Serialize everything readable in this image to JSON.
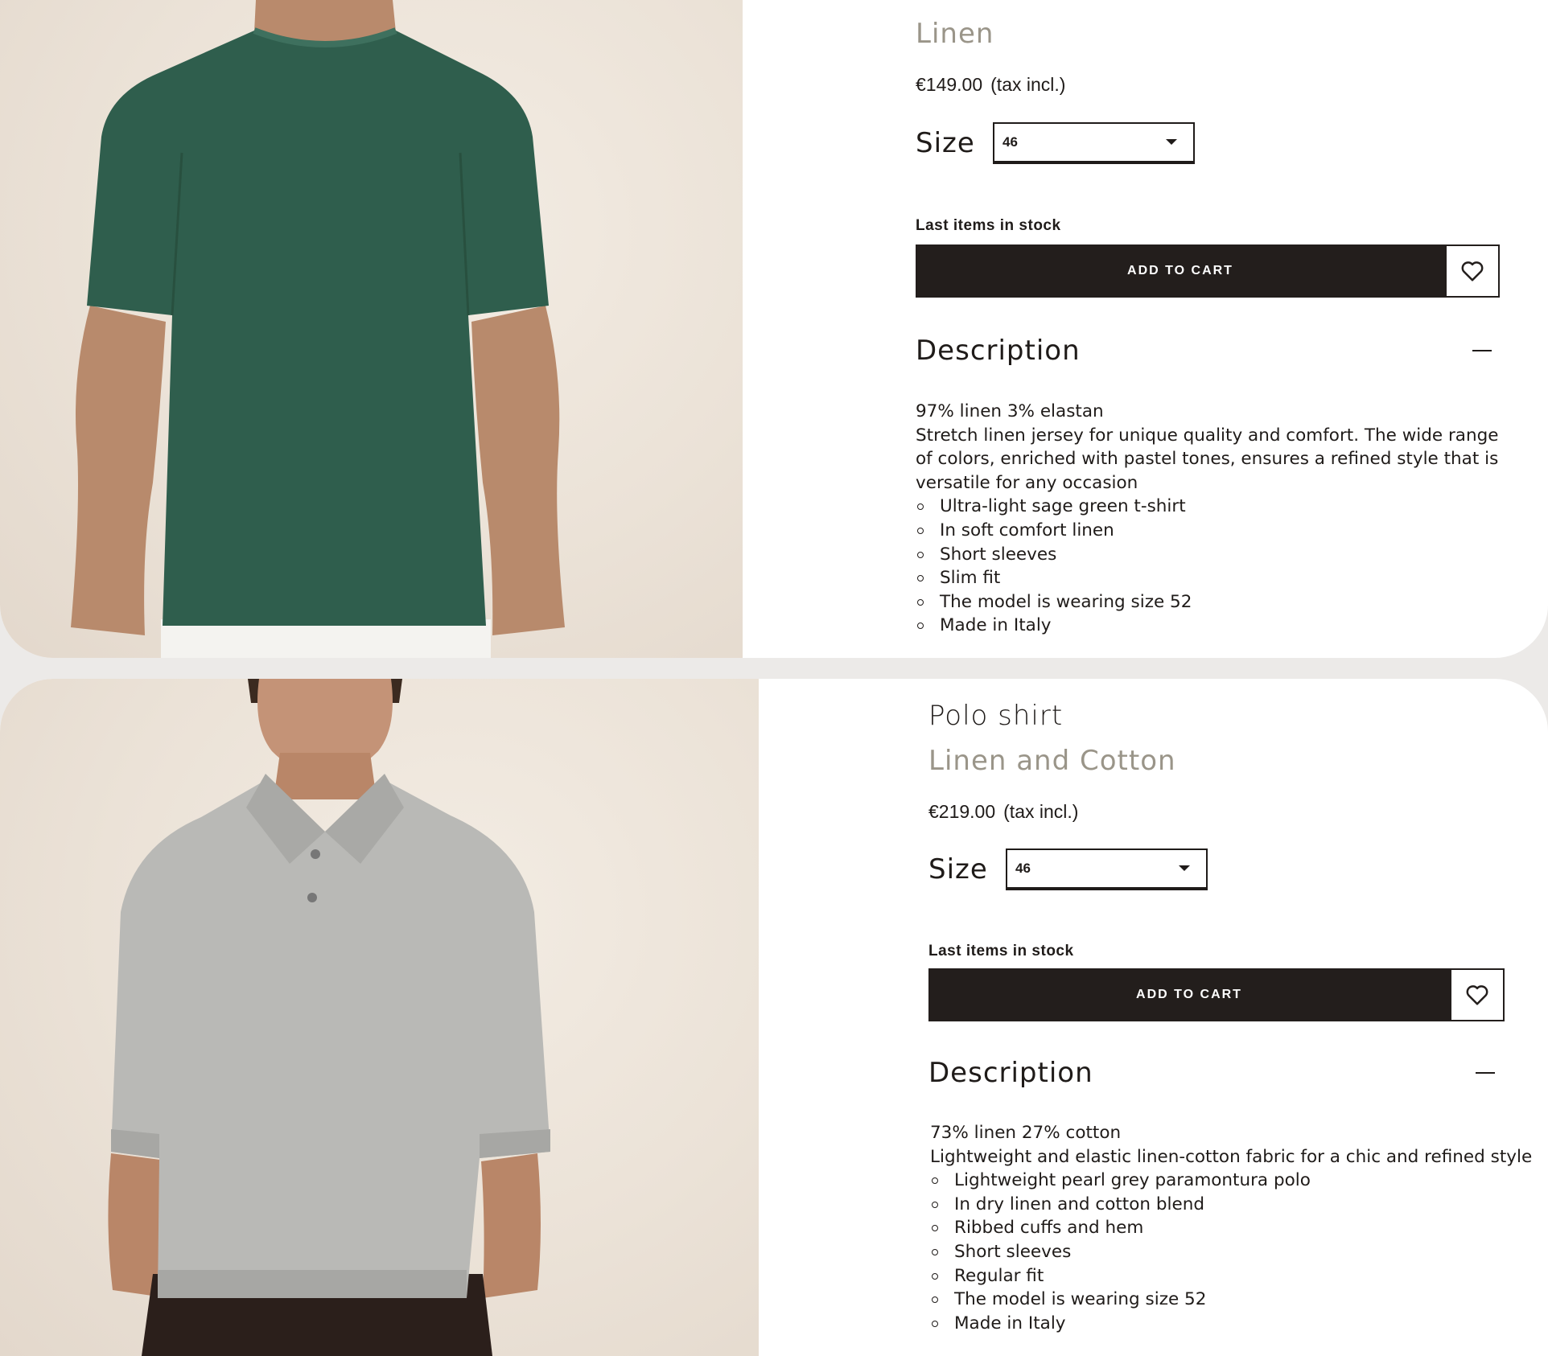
{
  "products": [
    {
      "subtitle": "Linen",
      "price": "€149.00",
      "tax": "(tax incl.)",
      "size_label": "Size",
      "size_value": "46",
      "stock": "Last items in stock",
      "add_to_cart": "ADD TO CART",
      "description_label": "Description",
      "composition": "97% linen 3% elastan",
      "description": "Stretch linen jersey for unique quality and comfort. The wide range of colors, enriched with pastel tones, ensures a refined style that is versatile for any occasion",
      "features": [
        "Ultra-light sage green t-shirt",
        "In soft comfort linen",
        "Short sleeves",
        "Slim fit",
        "The model is wearing size 52",
        "Made in Italy"
      ],
      "colors": {
        "garment": "#2f5e4d",
        "background": "#ede4d9"
      }
    },
    {
      "title": "Polo shirt",
      "subtitle": "Linen and Cotton",
      "price": "€219.00",
      "tax": "(tax incl.)",
      "size_label": "Size",
      "size_value": "46",
      "stock": "Last items in stock",
      "add_to_cart": "ADD TO CART",
      "description_label": "Description",
      "composition": "73% linen 27% cotton",
      "description": "Lightweight and elastic linen-cotton fabric for a chic and refined style",
      "features": [
        "Lightweight pearl grey paramontura polo",
        "In dry linen and cotton blend",
        "Ribbed cuffs and hem",
        "Short sleeves",
        "Regular fit",
        "The model is wearing size 52",
        "Made in Italy"
      ],
      "colors": {
        "garment": "#b9b9b6",
        "background": "#ede4d9"
      }
    }
  ]
}
